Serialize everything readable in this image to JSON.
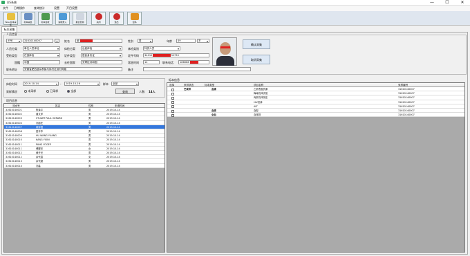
{
  "window": {
    "title": "LIS系统",
    "controls": [
      "—",
      "☐",
      "✕"
    ]
  },
  "menu": [
    "文件",
    "日常操作",
    "查询统计",
    "设置",
    "开目设置"
  ],
  "toolbar": [
    {
      "label": "Take\n标本采集",
      "name": "specimen-collect",
      "color": "#e7c040"
    },
    {
      "label": "标本采集",
      "name": "specimen-collect-2",
      "color": "#6a8fc2"
    },
    {
      "label": "标本签收",
      "name": "specimen-receive",
      "color": "#4e9a4e"
    },
    {
      "label": "编辑录入",
      "name": "edit-entry",
      "color": "#4e9ad6"
    },
    {
      "label": "报表查询",
      "name": "report-query",
      "color": "#d0d6e0"
    },
    {
      "label": "关闭",
      "name": "close",
      "color": "#c92a2a"
    },
    {
      "label": "退出",
      "name": "exit",
      "color": "#c92a2a"
    },
    {
      "label": "证码",
      "name": "code",
      "color": "#e09020"
    }
  ],
  "tab": "标本采集",
  "person": {
    "group_title": "人员信息",
    "id_type": "卡号",
    "id_value": "31610140007",
    "name_label": "姓名",
    "name_value": "柳",
    "gender_label": "性别",
    "gender_value": "男",
    "age_label": "年龄",
    "age_value": "49",
    "age_unit": "岁",
    "category_label": "人员分类",
    "category_value": "单位人员体检",
    "group_label": "体检方案",
    "group_value": "出差体检",
    "nature_label": "体检类别",
    "nature_value": "特供人员",
    "cert_type_label": "受检类型",
    "cert_type_value": "在逃体检",
    "cert_label": "证件类型",
    "cert_value": "居民身份证",
    "cert_no_label": "证件号码",
    "cert_no_value": "34012",
    "cert_no_tail": "32739",
    "nation_label": "国籍",
    "nation_value": "中国",
    "origin_label": "去往国家",
    "origin_value": "安哥拉共和国",
    "contact_label": "常驻时间",
    "contact_value": "12",
    "phone_label": "联系电话",
    "phone_value": "186086",
    "addr_label": "联系地址",
    "addr_value": "安徽省肥西县杂孝镇马岗村社前村同路",
    "remark_label": "备注",
    "remark_value": "",
    "btn_collect": "确认采集",
    "btn_cancel": "取消采集"
  },
  "filter": {
    "date_label": "体检时间",
    "date_from": "2019-10-14",
    "date_to": "2019-10-16",
    "to_sep": "-",
    "specimen_label": "样本",
    "specimen_value": "全部",
    "status_label": "采样情况",
    "radios": [
      "未采样",
      "已采样",
      "全部"
    ],
    "selected": 2,
    "query": "查询",
    "count_label": "人数:",
    "count_value": "14人"
  },
  "list": {
    "title": "项目信息",
    "headers": [
      "流水号",
      "姓名",
      "性别",
      "申请时间"
    ],
    "rows": [
      [
        "31610140001",
        "陈泽平",
        "男",
        "2019-10-14"
      ],
      [
        "31610140002",
        "曾文学",
        "男",
        "2019-10-14"
      ],
      [
        "31610140003",
        "STUART  PAUL GERARD",
        "男",
        "2019-10-14"
      ],
      [
        "31610140004",
        "刘霞在",
        "男",
        "2019-10-14"
      ],
      [
        "31610140007",
        "胡评语",
        "男",
        "2019-10-14"
      ],
      [
        "31610140008",
        "夏丰华",
        "男",
        "2019-10-14"
      ],
      [
        "31610140009",
        "HU  WANG YUANG",
        "男",
        "2019-10-14"
      ],
      [
        "31610140010",
        "KANG  YIXIN",
        "男",
        "2019-10-14"
      ],
      [
        "31610140011",
        "PANG  YOGEP",
        "男",
        "2019-10-14"
      ],
      [
        "31610140011",
        "傅娜珍",
        "女",
        "2019-10-14"
      ],
      [
        "31610140012",
        "黄开光",
        "男",
        "2019-10-14"
      ],
      [
        "31610140012",
        "余代霞",
        "女",
        "2019-10-14"
      ],
      [
        "31610140013",
        "余代超",
        "男",
        "2019-10-14"
      ],
      [
        "31610140014",
        "刘淼",
        "男",
        "2019-10-14"
      ]
    ],
    "selected": 4
  },
  "specimen": {
    "title": "标本信息",
    "headers": [
      "选择",
      "采样状态",
      "标本类型",
      "项目名称",
      "采样编号"
    ],
    "rows": [
      {
        "status": "已采样",
        "type": "血清",
        "item": "乙肝表面抗原",
        "code": "31610140007"
      },
      {
        "status": "",
        "type": "",
        "item": "梅毒抗体试验",
        "code": "31610140007"
      },
      {
        "status": "",
        "type": "",
        "item": "丙肝抗体测定",
        "code": "31610140007"
      },
      {
        "status": "",
        "type": "",
        "item": "HIV抗体",
        "code": "31610140007"
      },
      {
        "status": "",
        "type": "",
        "item": "ALT",
        "code": "31610140007"
      },
      {
        "status": "",
        "type": "血液",
        "item": "血型",
        "code": "31610140007"
      },
      {
        "status": "",
        "type": "全血",
        "item": "血常规",
        "code": "31610140007"
      }
    ]
  }
}
